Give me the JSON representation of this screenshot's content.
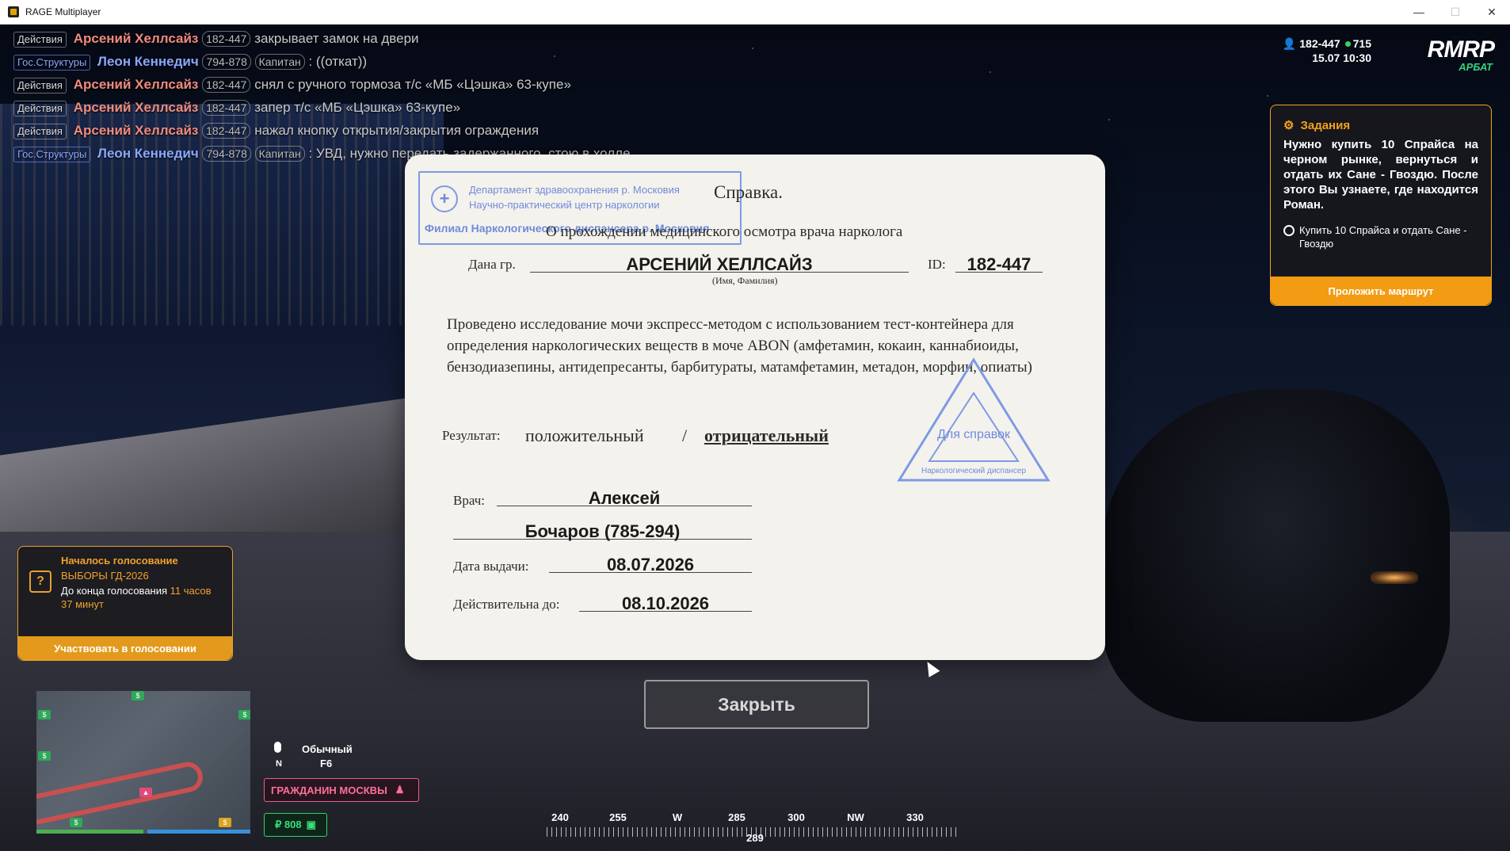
{
  "window": {
    "title": "RAGE Multiplayer",
    "minimize": "—",
    "maximize": "☐",
    "close": "✕"
  },
  "chat": [
    {
      "tag": "Действия",
      "name": "Арсений Хеллсайз",
      "id": "182-447",
      "rank": "",
      "text": "закрывает замок на двери",
      "gov": false
    },
    {
      "tag": "Гос.Структуры",
      "name": "Леон Кеннедич",
      "id": "794-878",
      "rank": "Капитан",
      "text": ": ((откат))",
      "gov": true
    },
    {
      "tag": "Действия",
      "name": "Арсений Хеллсайз",
      "id": "182-447",
      "rank": "",
      "text": "снял с ручного тормоза т/с «МБ «Цэшка» 63-купе»",
      "gov": false
    },
    {
      "tag": "Действия",
      "name": "Арсений Хеллсайз",
      "id": "182-447",
      "rank": "",
      "text": "запер т/с «МБ «Цэшка» 63-купе»",
      "gov": false
    },
    {
      "tag": "Действия",
      "name": "Арсений Хеллсайз",
      "id": "182-447",
      "rank": "",
      "text": "нажал кнопку открытия/закрытия ограждения",
      "gov": false
    },
    {
      "tag": "Гос.Структуры",
      "name": "Леон Кеннедич",
      "id": "794-878",
      "rank": "Капитан",
      "text": ": УВД, нужно передать задержанного, стою в холле",
      "gov": true
    }
  ],
  "hud": {
    "player_id": "182-447",
    "online": "715",
    "date": "15.07",
    "time": "10:30",
    "brand": "RMRP",
    "server": "АРБАТ"
  },
  "quest": {
    "header": "Задания",
    "text": "Нужно купить 10 Спрайса на черном рынке, вернуться и отдать их Сане - Гвоздю. После этого Вы узнаете, где находится Роман.",
    "task": "Купить 10 Спрайса и отдать Сане - Гвоздю",
    "button": "Проложить маршрут",
    "accent": "#f39b12"
  },
  "vote": {
    "title": "Началось голосование",
    "subtitle": "ВЫБОРЫ ГД-2026",
    "time_label": "До конца голосования",
    "time_value": "11 часов 37 минут",
    "button": "Участвовать в голосовании"
  },
  "voice": {
    "mode": "Обычный",
    "key": "F6",
    "direction": "N"
  },
  "status": {
    "citizen": "ГРАЖДАНИН МОСКВЫ",
    "money": "₽ 808"
  },
  "compass": {
    "marks": [
      "240",
      "255",
      "W",
      "285",
      "300",
      "NW",
      "330"
    ],
    "current": "289"
  },
  "document": {
    "stamp_line1": "Департамент здравоохранения р. Московия",
    "stamp_line2": "Научно-практический центр наркологии",
    "stamp_line3": "Филиал Наркологического диспансера р. Московия",
    "title": "Справка.",
    "subtitle": "О прохождении медицинского осмотра врача нарколога",
    "given_label": "Дана гр.",
    "given_value": "АРСЕНИЙ ХЕЛЛСАЙЗ",
    "given_hint": "(Имя, Фамилия)",
    "id_label": "ID:",
    "id_value": "182-447",
    "body": "Проведено исследование мочи экспресс-методом с использованием тест-контейнера для определения наркологических веществ в моче ABON (амфетамин, кокаин, каннабиоиды, бензодиазепины, антидепресанты, барбитураты, матамфетамин, метадон, морфин, опиаты)",
    "result_label": "Результат:",
    "result_positive": "положительный",
    "result_sep": "/",
    "result_negative": "отрицательный",
    "triangle_text": "Для справок",
    "triangle_bottom": "Наркологический диспансер",
    "doctor_label": "Врач:",
    "doctor_first": "Алексей",
    "doctor_last": "Бочаров (785-294)",
    "issue_label": "Дата выдачи:",
    "issue_value": "08.07.2026",
    "valid_label": "Действительна до:",
    "valid_value": "08.10.2026",
    "stamp_color": "#6f8bdc"
  },
  "close_button": "Закрыть"
}
